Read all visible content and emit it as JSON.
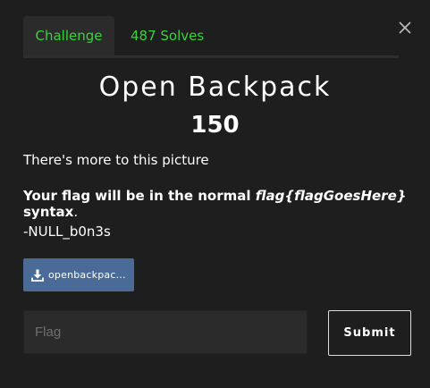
{
  "tabs": {
    "challenge": "Challenge",
    "solves": "487 Solves"
  },
  "challenge": {
    "name": "Open Backpack",
    "value": "150",
    "description": {
      "line1": "There's more to this picture",
      "line2_prefix": "Your flag will be in the normal ",
      "line2_format": "flag{flagGoesHere}",
      "line2_suffix": " syntax",
      "line2_period": ".",
      "line3": "-NULL_b0n3s"
    },
    "file_label": "openbackpac..."
  },
  "form": {
    "flag_placeholder": "Flag",
    "submit_label": "Submit"
  },
  "colors": {
    "background": "#1e1e1e",
    "tab_text": "#3bd13b",
    "file_button": "#4a6b97"
  },
  "icons": {
    "close": "close-icon",
    "download": "download-icon"
  }
}
